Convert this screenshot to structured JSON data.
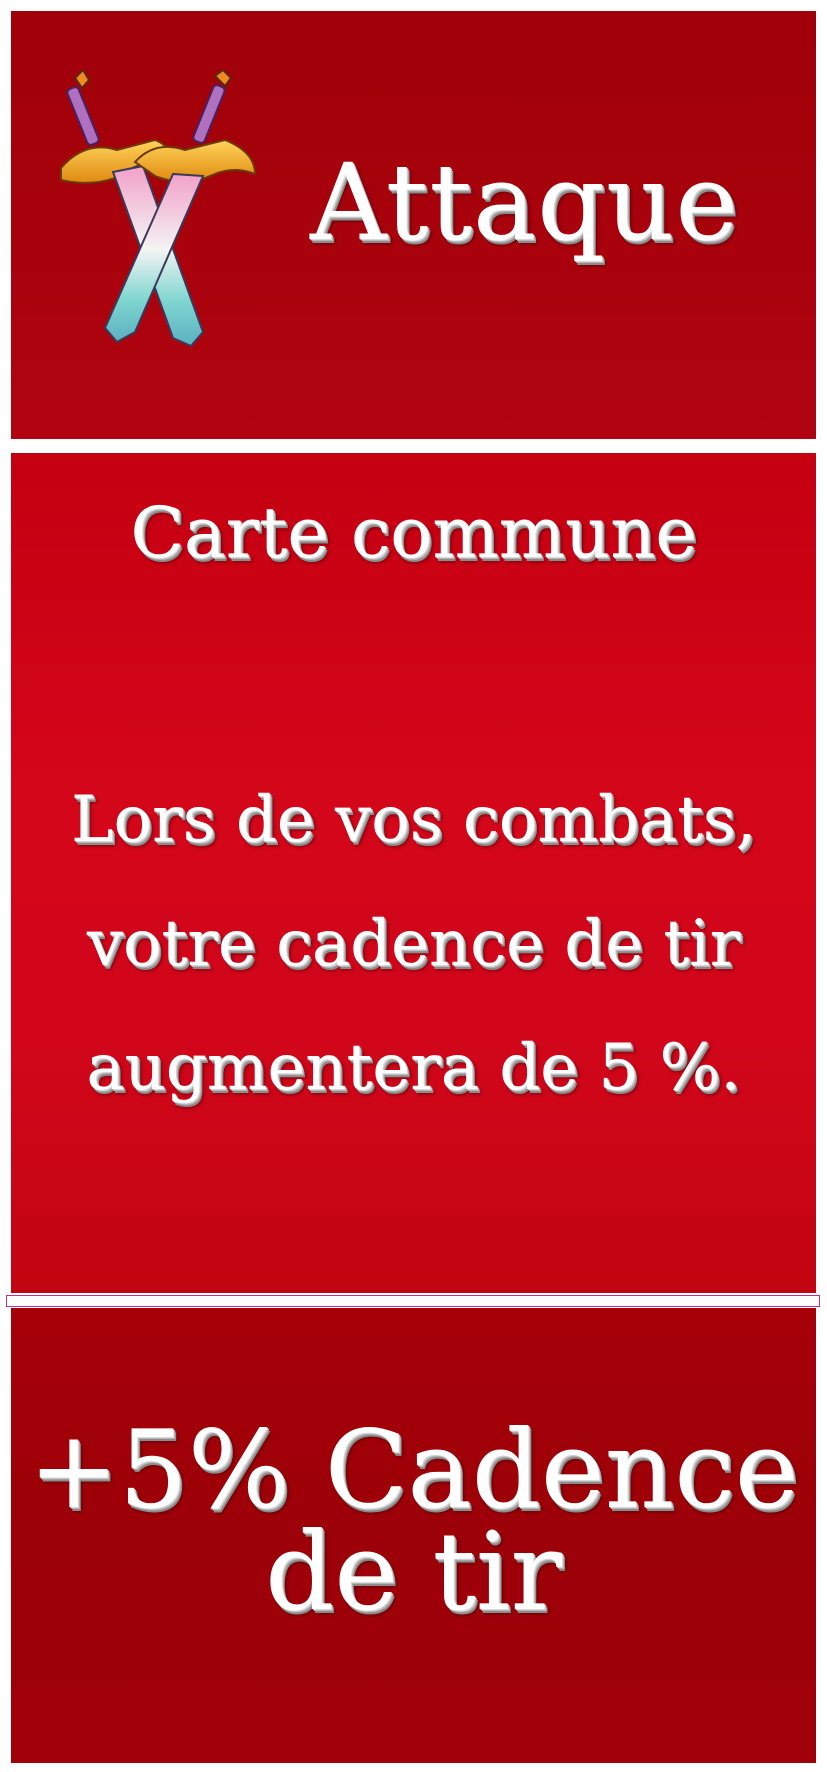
{
  "card": {
    "type_title": "Attaque",
    "type_icon": "crossed-swords-icon",
    "rarity": "Carte commune",
    "description_lines": [
      "Lors de vos combats,",
      "votre cadence de tir",
      "augmentera de 5 %."
    ],
    "bonus_lines": [
      "+5% Cadence",
      "de tir"
    ]
  },
  "colors": {
    "panel_red_dark": "#a00009",
    "panel_red_bright": "#d4061a",
    "text": "#ffffff",
    "separator_border": "#c0308a"
  }
}
